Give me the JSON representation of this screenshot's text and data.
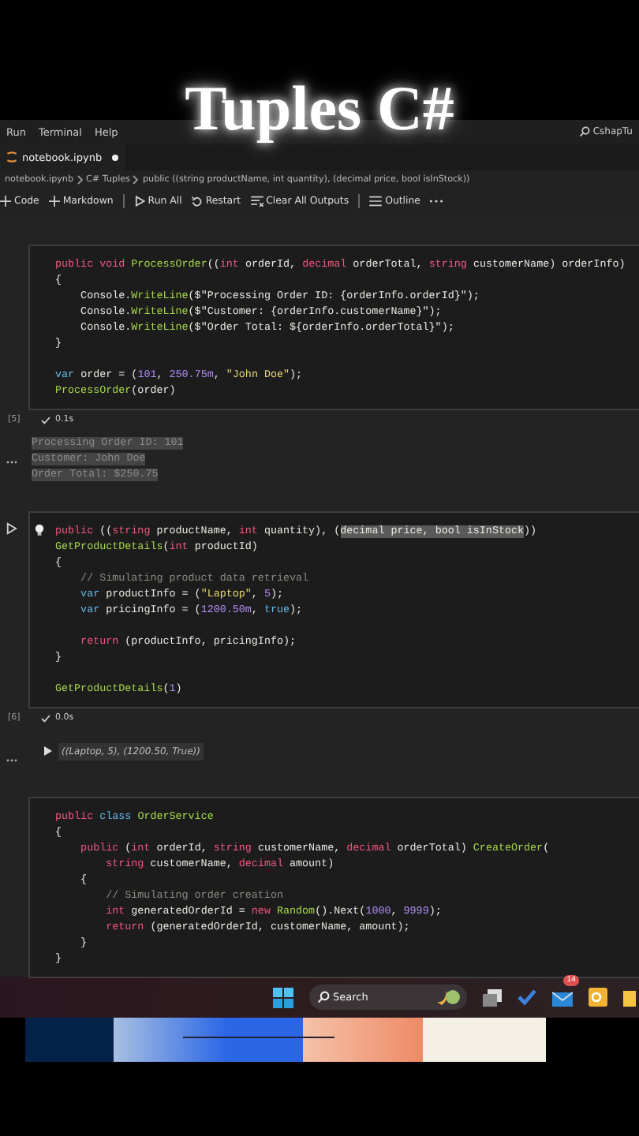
{
  "overlay_title": "Tuples C#",
  "menu": [
    "Run",
    "Terminal",
    "Help"
  ],
  "search": {
    "value": "CshapTu"
  },
  "tab": {
    "label": "notebook.ipynb",
    "modified": true
  },
  "breadcrumb": [
    "notebook.ipynb",
    "C# Tuples",
    "public ((string productName, int quantity), (decimal price, bool isInStock))"
  ],
  "toolbar": [
    {
      "kind": "code",
      "label": "Code"
    },
    {
      "kind": "markdown",
      "label": "Markdown"
    },
    {
      "kind": "sep"
    },
    {
      "kind": "run",
      "label": "Run All"
    },
    {
      "kind": "restart",
      "label": "Restart"
    },
    {
      "kind": "clear",
      "label": "Clear All Outputs"
    },
    {
      "kind": "sep"
    },
    {
      "kind": "outline",
      "label": "Outline"
    },
    {
      "kind": "more"
    }
  ],
  "cells": [
    {
      "run_button": false,
      "exec_count": "[5]",
      "time": "0.1s",
      "lines": [
        {
          "kind": "code",
          "tokens": [
            {
              "kind": "kw",
              "text": "public "
            },
            {
              "kind": "kw",
              "text": "void "
            },
            {
              "kind": "fn",
              "text": "ProcessOrder"
            },
            {
              "kind": "p",
              "text": "(("
            },
            {
              "kind": "kw",
              "text": "int "
            },
            {
              "kind": "p",
              "text": "orderId, "
            },
            {
              "kind": "kw",
              "text": "decimal "
            },
            {
              "kind": "p",
              "text": "orderTotal, "
            },
            {
              "kind": "kw",
              "text": "string "
            },
            {
              "kind": "p",
              "text": "customerName) orderInfo)"
            }
          ]
        },
        {
          "kind": "code",
          "tokens": [
            {
              "kind": "p",
              "text": "{"
            }
          ]
        },
        {
          "kind": "code",
          "tokens": [
            {
              "kind": "p",
              "text": "    Console."
            },
            {
              "kind": "fn",
              "text": "WriteLine"
            },
            {
              "kind": "p",
              "text": "($\"Processing Order ID: {orderInfo.orderId}\");"
            }
          ]
        },
        {
          "kind": "code",
          "tokens": [
            {
              "kind": "p",
              "text": "    Console."
            },
            {
              "kind": "fn",
              "text": "WriteLine"
            },
            {
              "kind": "p",
              "text": "($\"Customer: {orderInfo.customerName}\");"
            }
          ]
        },
        {
          "kind": "code",
          "tokens": [
            {
              "kind": "p",
              "text": "    Console."
            },
            {
              "kind": "fn",
              "text": "WriteLine"
            },
            {
              "kind": "p",
              "text": "($\"Order Total: ${orderInfo.orderTotal}\");"
            }
          ]
        },
        {
          "kind": "code",
          "tokens": [
            {
              "kind": "p",
              "text": "}"
            }
          ]
        },
        {
          "kind": "blank"
        },
        {
          "kind": "code",
          "tokens": [
            {
              "kind": "decl",
              "text": "var "
            },
            {
              "kind": "p",
              "text": "order = ("
            },
            {
              "kind": "num",
              "text": "101"
            },
            {
              "kind": "p",
              "text": ", "
            },
            {
              "kind": "num",
              "text": "250.75m"
            },
            {
              "kind": "p",
              "text": ", "
            },
            {
              "kind": "str",
              "text": "\"John Doe\""
            },
            {
              "kind": "p",
              "text": ");"
            }
          ]
        },
        {
          "kind": "code",
          "tokens": [
            {
              "kind": "fn",
              "text": "ProcessOrder"
            },
            {
              "kind": "p",
              "text": "(order)"
            }
          ]
        }
      ],
      "output": {
        "kind": "text",
        "lines": [
          "Processing Order ID: 101",
          "Customer: John Doe",
          "Order Total: $250.75"
        ]
      }
    },
    {
      "run_button": true,
      "exec_count": "[6]",
      "time": "0.0s",
      "lines": [
        {
          "kind": "code",
          "tokens": [
            {
              "kind": "kw",
              "text": "public "
            },
            {
              "kind": "p",
              "text": "(("
            },
            {
              "kind": "kw",
              "text": "string "
            },
            {
              "kind": "p",
              "text": "productName, "
            },
            {
              "kind": "kw",
              "text": "int "
            },
            {
              "kind": "p",
              "text": "quantity), ("
            },
            {
              "kind": "sel",
              "text": "decimal price, bool isInStock"
            },
            {
              "kind": "p",
              "text": "))"
            }
          ]
        },
        {
          "kind": "code",
          "tokens": [
            {
              "kind": "fn",
              "text": "GetProductDetails"
            },
            {
              "kind": "p",
              "text": "("
            },
            {
              "kind": "kw",
              "text": "int "
            },
            {
              "kind": "p",
              "text": "productId)"
            }
          ]
        },
        {
          "kind": "code",
          "tokens": [
            {
              "kind": "p",
              "text": "{"
            }
          ]
        },
        {
          "kind": "code",
          "tokens": [
            {
              "kind": "cm",
              "text": "    // Simulating product data retrieval"
            }
          ]
        },
        {
          "kind": "code",
          "tokens": [
            {
              "kind": "decl",
              "text": "    var "
            },
            {
              "kind": "p",
              "text": "productInfo = ("
            },
            {
              "kind": "str",
              "text": "\"Laptop\""
            },
            {
              "kind": "p",
              "text": ", "
            },
            {
              "kind": "num",
              "text": "5"
            },
            {
              "kind": "p",
              "text": ");"
            }
          ]
        },
        {
          "kind": "code",
          "tokens": [
            {
              "kind": "decl",
              "text": "    var "
            },
            {
              "kind": "p",
              "text": "pricingInfo = ("
            },
            {
              "kind": "num",
              "text": "1200.50m"
            },
            {
              "kind": "p",
              "text": ", "
            },
            {
              "kind": "decl",
              "text": "true"
            },
            {
              "kind": "p",
              "text": ");"
            }
          ]
        },
        {
          "kind": "blank"
        },
        {
          "kind": "code",
          "tokens": [
            {
              "kind": "kw",
              "text": "    return "
            },
            {
              "kind": "p",
              "text": "(productInfo, pricingInfo);"
            }
          ]
        },
        {
          "kind": "code",
          "tokens": [
            {
              "kind": "p",
              "text": "}"
            }
          ]
        },
        {
          "kind": "blank"
        },
        {
          "kind": "code",
          "tokens": [
            {
              "kind": "fn",
              "text": "GetProductDetails"
            },
            {
              "kind": "p",
              "text": "("
            },
            {
              "kind": "num",
              "text": "1"
            },
            {
              "kind": "p",
              "text": ")"
            }
          ]
        }
      ],
      "output": {
        "kind": "tuple",
        "lines": [
          "((Laptop, 5), (1200.50, True))"
        ]
      }
    },
    {
      "run_button": false,
      "lines": [
        {
          "kind": "code",
          "tokens": [
            {
              "kind": "kw",
              "text": "public "
            },
            {
              "kind": "decl",
              "text": "class "
            },
            {
              "kind": "fn",
              "text": "OrderService"
            }
          ]
        },
        {
          "kind": "code",
          "tokens": [
            {
              "kind": "p",
              "text": "{"
            }
          ]
        },
        {
          "kind": "code",
          "tokens": [
            {
              "kind": "kw",
              "text": "    public "
            },
            {
              "kind": "p",
              "text": "("
            },
            {
              "kind": "kw",
              "text": "int "
            },
            {
              "kind": "p",
              "text": "orderId, "
            },
            {
              "kind": "kw",
              "text": "string "
            },
            {
              "kind": "p",
              "text": "customerName, "
            },
            {
              "kind": "kw",
              "text": "decimal "
            },
            {
              "kind": "p",
              "text": "orderTotal) "
            },
            {
              "kind": "fn",
              "text": "CreateOrder"
            },
            {
              "kind": "p",
              "text": "("
            }
          ]
        },
        {
          "kind": "code",
          "tokens": [
            {
              "kind": "kw",
              "text": "        string "
            },
            {
              "kind": "p",
              "text": "customerName, "
            },
            {
              "kind": "kw",
              "text": "decimal "
            },
            {
              "kind": "p",
              "text": "amount)"
            }
          ]
        },
        {
          "kind": "code",
          "tokens": [
            {
              "kind": "p",
              "text": "    {"
            }
          ]
        },
        {
          "kind": "code",
          "tokens": [
            {
              "kind": "cm",
              "text": "        // Simulating order creation"
            }
          ]
        },
        {
          "kind": "code",
          "tokens": [
            {
              "kind": "kw",
              "text": "        int "
            },
            {
              "kind": "p",
              "text": "generatedOrderId = "
            },
            {
              "kind": "kw",
              "text": "new "
            },
            {
              "kind": "fn",
              "text": "Random"
            },
            {
              "kind": "p",
              "text": "().Next("
            },
            {
              "kind": "num",
              "text": "1000"
            },
            {
              "kind": "p",
              "text": ", "
            },
            {
              "kind": "num",
              "text": "9999"
            },
            {
              "kind": "p",
              "text": ");"
            }
          ]
        },
        {
          "kind": "code",
          "tokens": [
            {
              "kind": "kw",
              "text": "        return "
            },
            {
              "kind": "p",
              "text": "(generatedOrderId, customerName, amount);"
            }
          ]
        },
        {
          "kind": "code",
          "tokens": [
            {
              "kind": "p",
              "text": "    }"
            }
          ]
        },
        {
          "kind": "code",
          "tokens": [
            {
              "kind": "p",
              "text": "}"
            }
          ]
        }
      ]
    }
  ],
  "taskbar": {
    "search": {
      "placeholder": "Search"
    },
    "mail_badge": "14"
  }
}
